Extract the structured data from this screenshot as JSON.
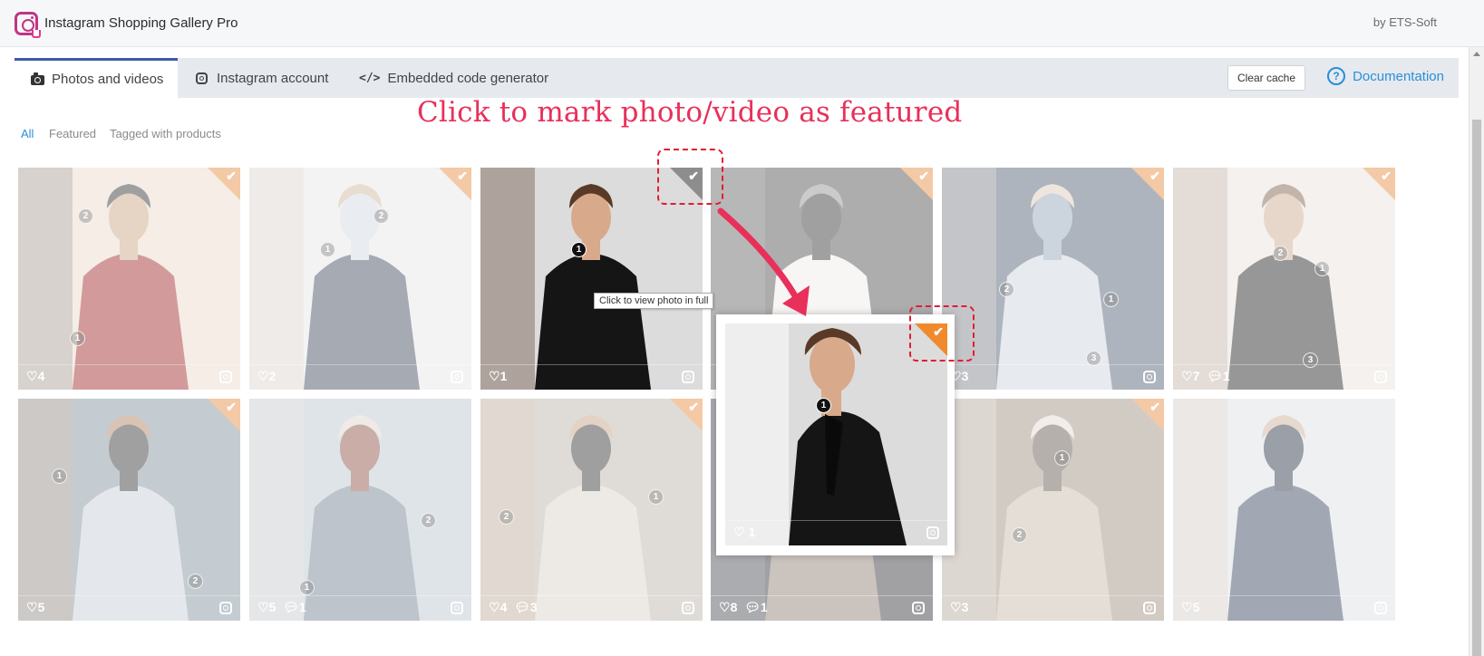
{
  "header": {
    "app_title": "Instagram Shopping Gallery Pro",
    "byline": "by ETS-Soft",
    "logo_icon": "instagram-shopping-logo-icon"
  },
  "tabs": [
    {
      "label": "Photos and videos",
      "icon": "camera-icon",
      "active": true
    },
    {
      "label": "Instagram account",
      "icon": "instagram-icon",
      "active": false
    },
    {
      "label": "Embedded code generator",
      "icon": "code-icon",
      "active": false
    }
  ],
  "toolbar": {
    "clear_cache_label": "Clear cache",
    "documentation_label": "Documentation"
  },
  "filters": [
    {
      "label": "All",
      "active": true
    },
    {
      "label": "Featured",
      "active": false
    },
    {
      "label": "Tagged with products",
      "active": false
    }
  ],
  "annotation": {
    "text": "Click to mark photo/video as featured"
  },
  "tooltip": {
    "text": "Click to view photo in full"
  },
  "gallery": {
    "rows": [
      [
        {
          "likes": "4",
          "comments": "",
          "featured": true,
          "tags": [
            "2",
            "1"
          ]
        },
        {
          "likes": "2",
          "comments": "",
          "featured": true,
          "tags": [
            "2",
            "1"
          ]
        },
        {
          "likes": "1",
          "comments": "",
          "featured": false,
          "tags": [
            "1"
          ]
        },
        {
          "likes": "",
          "comments": "",
          "featured": true,
          "tags": []
        },
        {
          "likes": "3",
          "comments": "",
          "featured": true,
          "tags": [
            "2",
            "1",
            "3"
          ]
        },
        {
          "likes": "7",
          "comments": "1",
          "featured": true,
          "tags": [
            "2",
            "1",
            "3"
          ]
        }
      ],
      [
        {
          "likes": "5",
          "comments": "",
          "featured": true,
          "tags": [
            "1",
            "2"
          ]
        },
        {
          "likes": "5",
          "comments": "1",
          "featured": false,
          "tags": [
            "2",
            "1"
          ]
        },
        {
          "likes": "4",
          "comments": "3",
          "featured": true,
          "tags": [
            "2",
            "1"
          ]
        },
        {
          "likes": "8",
          "comments": "1",
          "featured": false,
          "tags": []
        },
        {
          "likes": "3",
          "comments": "",
          "featured": true,
          "tags": [
            "1",
            "2"
          ]
        },
        {
          "likes": "5",
          "comments": "",
          "featured": false,
          "tags": []
        }
      ]
    ]
  },
  "popup": {
    "likes": "1",
    "tag": "1",
    "featured": true
  },
  "colors": {
    "accent": "#2a8fd8",
    "annotation": "#e8305a",
    "featured_corner": "#f08a2c",
    "active_tab_border": "#3b5ba9"
  }
}
